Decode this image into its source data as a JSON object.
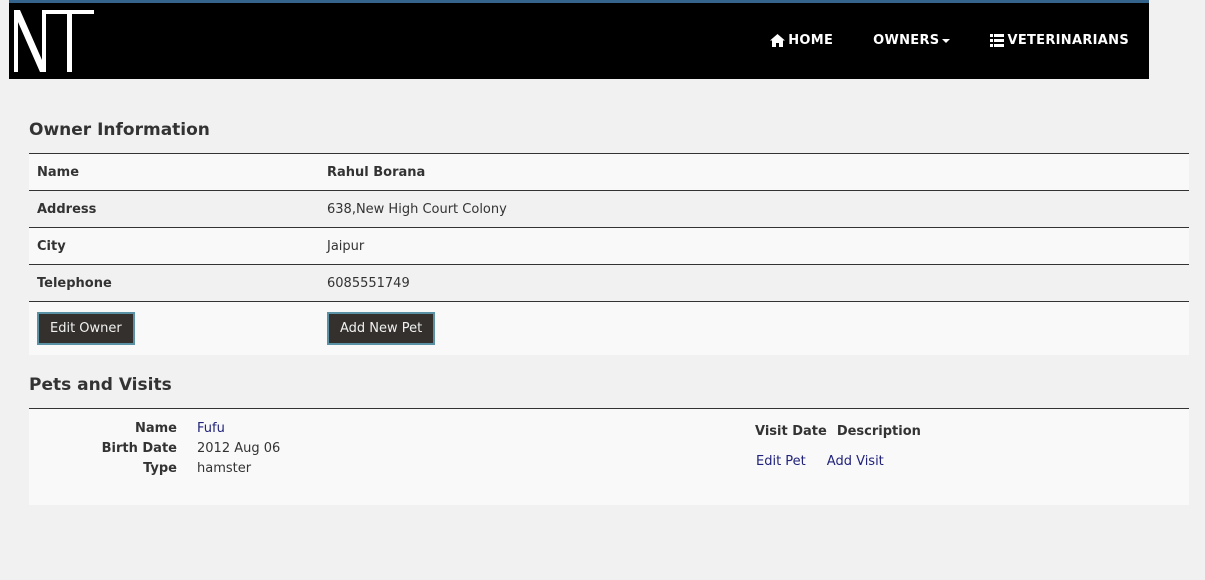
{
  "nav": {
    "logo_text": "NT",
    "home": "HOME",
    "owners": "OWNERS",
    "veterinarians": "VETERINARIANS"
  },
  "owner_section": {
    "title": "Owner Information",
    "rows": [
      {
        "label": "Name",
        "value": "Rahul Borana"
      },
      {
        "label": "Address",
        "value": "638,New High Court Colony"
      },
      {
        "label": "City",
        "value": "Jaipur"
      },
      {
        "label": "Telephone",
        "value": "6085551749"
      }
    ],
    "edit_button": "Edit Owner",
    "add_pet_button": "Add New Pet"
  },
  "pets_section": {
    "title": "Pets and Visits",
    "pet": {
      "name_label": "Name",
      "name": "Fufu",
      "birth_label": "Birth Date",
      "birth": "2012 Aug 06",
      "type_label": "Type",
      "type": "hamster"
    },
    "visit_date_header": "Visit Date",
    "description_header": "Description",
    "edit_pet_link": "Edit Pet",
    "add_visit_link": "Add Visit"
  },
  "colors": {
    "nav_bg": "#000000",
    "nav_top_border": "#34648c",
    "button_bg": "#34302d",
    "button_border": "#5b91a5",
    "link": "#21237a"
  }
}
